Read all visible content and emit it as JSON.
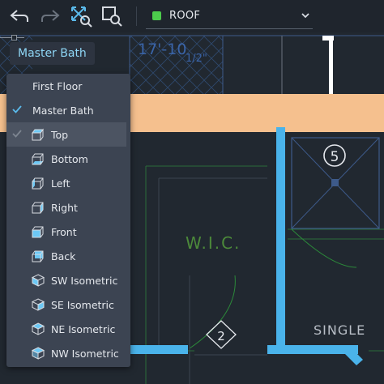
{
  "toolbar": {
    "icons": [
      "undo-icon",
      "redo-icon",
      "zoom-extents-icon",
      "zoom-window-icon"
    ],
    "layer": {
      "name": "ROOF",
      "swatch_color": "#4ccc4c"
    }
  },
  "drawing": {
    "dimension_text": "17'-10",
    "dimension_fraction": "1/2\"",
    "room_label": "W.I.C.",
    "room_label_2": "SINGLE",
    "marker_5": "5",
    "marker_2": "2"
  },
  "view_button": {
    "label": "Master Bath"
  },
  "menu": {
    "items": [
      {
        "label": "First Floor",
        "checked": false,
        "icon": null
      },
      {
        "label": "Master Bath",
        "checked": true,
        "icon": null
      },
      {
        "label": "Top",
        "checked": true,
        "icon": "cube-top-icon",
        "highlighted": true
      },
      {
        "label": "Bottom",
        "checked": false,
        "icon": "cube-bottom-icon"
      },
      {
        "label": "Left",
        "checked": false,
        "icon": "cube-left-icon"
      },
      {
        "label": "Right",
        "checked": false,
        "icon": "cube-right-icon"
      },
      {
        "label": "Front",
        "checked": false,
        "icon": "cube-front-icon"
      },
      {
        "label": "Back",
        "checked": false,
        "icon": "cube-back-icon"
      },
      {
        "label": "SW Isometric",
        "checked": false,
        "icon": "cube-sw-isometric-icon"
      },
      {
        "label": "SE Isometric",
        "checked": false,
        "icon": "cube-se-isometric-icon"
      },
      {
        "label": "NE Isometric",
        "checked": false,
        "icon": "cube-ne-isometric-icon"
      },
      {
        "label": "NW Isometric",
        "checked": false,
        "icon": "cube-nw-isometric-icon"
      }
    ]
  },
  "colors": {
    "accent_blue": "#8ed6f5",
    "wall_blue": "#4ab3ea",
    "beam_orange": "#f5c08e",
    "menu_bg": "#3c4452"
  }
}
